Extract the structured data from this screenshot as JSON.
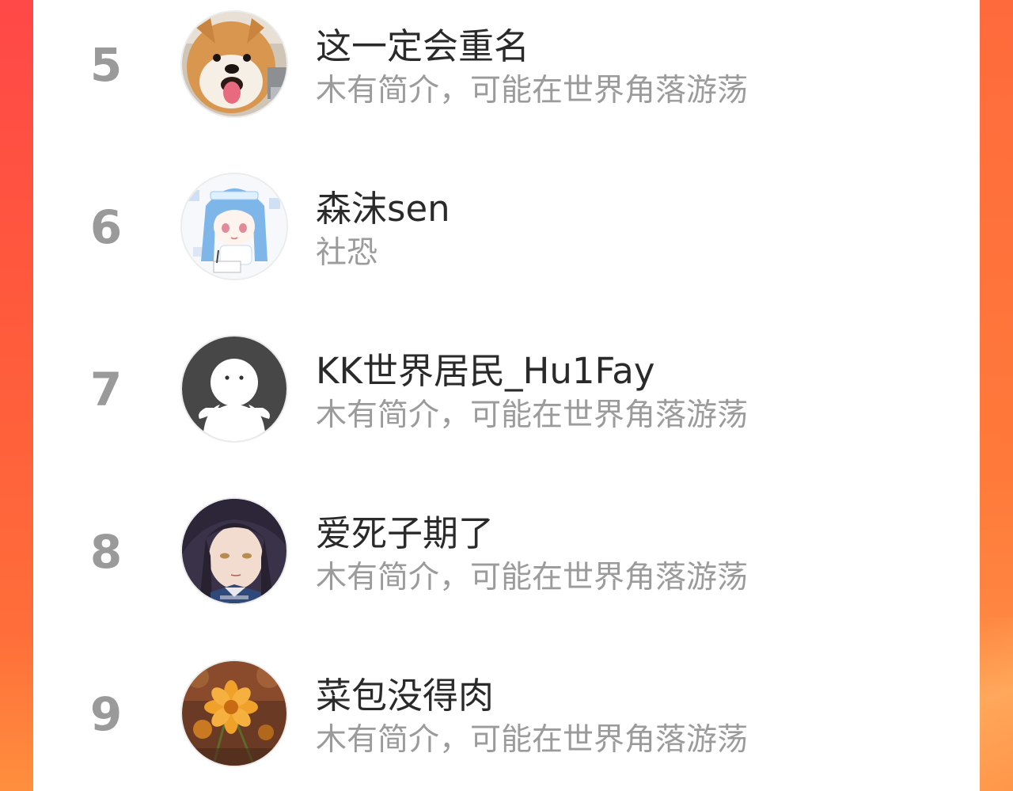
{
  "colors": {
    "background_gradient_top": "#ff4848",
    "background_gradient_bottom": "#ff8f3e",
    "card": "#ffffff",
    "rank_text": "#9a9a9a",
    "name_text": "#2a2a2a",
    "bio_text": "#9b9b9b"
  },
  "leaderboard": {
    "entries": [
      {
        "rank": "5",
        "name": "这一定会重名",
        "bio": "木有简介，可能在世界角落游荡",
        "avatar": "shiba-dog-avatar"
      },
      {
        "rank": "6",
        "name": "森沫sen",
        "bio": "社恐",
        "avatar": "anime-girl-avatar"
      },
      {
        "rank": "7",
        "name": "KK世界居民_Hu1Fay",
        "bio": "木有简介，可能在世界角落游荡",
        "avatar": "default-ghost-avatar"
      },
      {
        "rank": "8",
        "name": "爱死子期了",
        "bio": "木有简介，可能在世界角落游荡",
        "avatar": "anime-man-avatar"
      },
      {
        "rank": "9",
        "name": "菜包没得肉",
        "bio": "木有简介，可能在世界角落游荡",
        "avatar": "flower-avatar"
      }
    ]
  }
}
